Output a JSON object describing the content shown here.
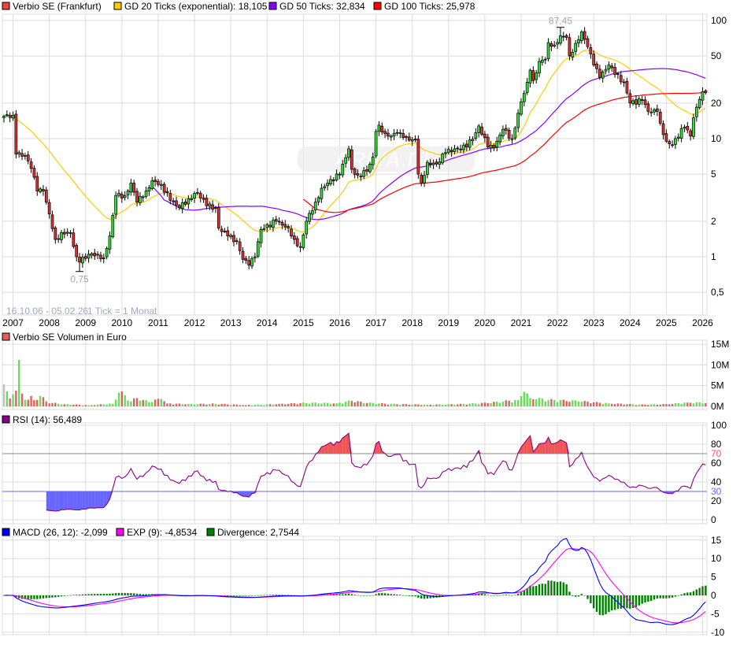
{
  "legend_main": [
    {
      "label": "Verbio SE (Frankfurt)",
      "color": "#ee4444"
    },
    {
      "label": "GD 20 Ticks (exponential): 18,105",
      "color": "#ffcc00"
    },
    {
      "label": "GD 50 Ticks: 32,834",
      "color": "#8800ff"
    },
    {
      "label": "GD 100 Ticks: 25,978",
      "color": "#ff0000"
    }
  ],
  "range_text": "16.10.06 - 05.02.26",
  "tick_text": "1 Tick = 1 Monat",
  "watermark": "ARIVA.DE",
  "chart_data": {
    "type": "candlestick",
    "title": "Verbio SE (Frankfurt)",
    "start_month": "2006-10",
    "interval": "1 month",
    "scale": "log",
    "ylim": [
      0.4,
      110
    ],
    "close_anchors": [
      [
        0,
        15.5
      ],
      [
        3,
        15.8
      ],
      [
        4,
        7.4
      ],
      [
        7,
        7.2
      ],
      [
        9,
        5.6
      ],
      [
        11,
        3.6
      ],
      [
        13,
        3.6
      ],
      [
        15,
        2.3
      ],
      [
        17,
        1.4
      ],
      [
        19,
        1.6
      ],
      [
        22,
        1.6
      ],
      [
        24,
        1.0
      ],
      [
        25,
        0.9
      ],
      [
        28,
        1.05
      ],
      [
        31,
        1.05
      ],
      [
        33,
        0.98
      ],
      [
        35,
        1.5
      ],
      [
        37,
        3.3
      ],
      [
        40,
        3.3
      ],
      [
        42,
        4.2
      ],
      [
        44,
        2.9
      ],
      [
        47,
        3.6
      ],
      [
        49,
        4.4
      ],
      [
        52,
        4.1
      ],
      [
        55,
        3.0
      ],
      [
        58,
        2.6
      ],
      [
        61,
        3.1
      ],
      [
        64,
        3.5
      ],
      [
        67,
        2.7
      ],
      [
        70,
        2.6
      ],
      [
        71,
        1.75
      ],
      [
        74,
        1.5
      ],
      [
        77,
        1.35
      ],
      [
        79,
        0.95
      ],
      [
        81,
        0.85
      ],
      [
        83,
        1.0
      ],
      [
        85,
        1.7
      ],
      [
        90,
        2.0
      ],
      [
        94,
        1.75
      ],
      [
        96,
        1.4
      ],
      [
        98,
        1.2
      ],
      [
        100,
        2.0
      ],
      [
        103,
        2.9
      ],
      [
        105,
        3.8
      ],
      [
        107,
        4.2
      ],
      [
        111,
        5.0
      ],
      [
        113,
        6.9
      ],
      [
        114,
        8.2
      ],
      [
        115,
        5.5
      ],
      [
        117,
        4.9
      ],
      [
        120,
        5.3
      ],
      [
        122,
        7.0
      ],
      [
        123,
        11.5
      ],
      [
        124,
        13.0
      ],
      [
        126,
        11.0
      ],
      [
        128,
        10.5
      ],
      [
        130,
        11.2
      ],
      [
        132,
        10.2
      ],
      [
        134,
        9.7
      ],
      [
        136,
        9.8
      ],
      [
        137,
        5.0
      ],
      [
        138,
        4.2
      ],
      [
        140,
        6.3
      ],
      [
        143,
        6.1
      ],
      [
        146,
        7.6
      ],
      [
        150,
        8.3
      ],
      [
        153,
        8.5
      ],
      [
        156,
        11.2
      ],
      [
        157,
        12.8
      ],
      [
        160,
        8.5
      ],
      [
        162,
        8.3
      ],
      [
        165,
        12.0
      ],
      [
        168,
        10.0
      ],
      [
        171,
        20.5
      ],
      [
        173,
        30
      ],
      [
        174,
        38
      ],
      [
        175,
        31
      ],
      [
        177,
        45
      ],
      [
        179,
        47
      ],
      [
        180,
        65
      ],
      [
        182,
        62
      ],
      [
        184,
        74
      ],
      [
        186,
        72
      ],
      [
        187,
        50
      ],
      [
        189,
        64
      ],
      [
        191,
        80
      ],
      [
        193,
        60
      ],
      [
        195,
        42
      ],
      [
        197,
        33
      ],
      [
        200,
        42
      ],
      [
        202,
        35
      ],
      [
        205,
        30
      ],
      [
        207,
        20
      ],
      [
        211,
        21
      ],
      [
        213,
        17
      ],
      [
        216,
        17
      ],
      [
        217,
        13.5
      ],
      [
        219,
        9.5
      ],
      [
        221,
        8.8
      ],
      [
        222,
        10
      ],
      [
        225,
        12.5
      ],
      [
        227,
        10.5
      ],
      [
        228,
        15
      ],
      [
        230,
        21.5
      ],
      [
        231,
        25
      ],
      [
        232,
        24.5
      ]
    ],
    "high": {
      "month": 184,
      "value": 87.45,
      "label": "87,45"
    },
    "low": {
      "month": 25,
      "value": 0.75,
      "label": "0,75"
    },
    "x_ticks": [
      "2007",
      "2008",
      "2009",
      "2010",
      "2011",
      "2012",
      "2013",
      "2014",
      "2015",
      "2016",
      "2017",
      "2018",
      "2019",
      "2020",
      "2021",
      "2022",
      "2023",
      "2024",
      "2025",
      "2026"
    ],
    "y_ticks": [
      {
        "v": 100,
        "label": "100"
      },
      {
        "v": 50,
        "label": "50"
      },
      {
        "v": 20,
        "label": "20"
      },
      {
        "v": 10,
        "label": "10"
      },
      {
        "v": 5,
        "label": "5"
      },
      {
        "v": 2,
        "label": "2"
      },
      {
        "v": 1,
        "label": "1"
      },
      {
        "v": 0.5,
        "label": "0,5"
      }
    ],
    "moving_averages": [
      {
        "name": "GD 20 (exponential)",
        "period": 20,
        "kind": "ema",
        "color": "#ffcc00"
      },
      {
        "name": "GD 50",
        "period": 50,
        "kind": "sma",
        "color": "#8800ff"
      },
      {
        "name": "GD 100",
        "period": 100,
        "kind": "sma",
        "color": "#ff0000"
      }
    ],
    "volume": {
      "title": "Verbio SE Volumen in Euro",
      "unit": "M EUR",
      "ylim": [
        0,
        15
      ],
      "ticks": [
        {
          "v": 15,
          "label": "15M"
        },
        {
          "v": 10,
          "label": "10M"
        },
        {
          "v": 5,
          "label": "5M"
        },
        {
          "v": 0,
          "label": "0M"
        }
      ],
      "anchors": [
        [
          0,
          5.3
        ],
        [
          1,
          3.6
        ],
        [
          2,
          1.9
        ],
        [
          3,
          2.9
        ],
        [
          4,
          3.8
        ],
        [
          5,
          11.2
        ],
        [
          6,
          3.1
        ],
        [
          7,
          1.6
        ],
        [
          8,
          1.6
        ],
        [
          9,
          2.5
        ],
        [
          10,
          1.5
        ],
        [
          12,
          2.5
        ],
        [
          14,
          1.2
        ],
        [
          16,
          0.8
        ],
        [
          20,
          0.5
        ],
        [
          28,
          0.3
        ],
        [
          36,
          0.6
        ],
        [
          38,
          3.3
        ],
        [
          39,
          3.6
        ],
        [
          40,
          2.7
        ],
        [
          42,
          1.2
        ],
        [
          44,
          2.0
        ],
        [
          46,
          1.5
        ],
        [
          48,
          1.0
        ],
        [
          52,
          1.8
        ],
        [
          54,
          0.7
        ],
        [
          60,
          0.5
        ],
        [
          70,
          0.6
        ],
        [
          80,
          0.3
        ],
        [
          90,
          0.5
        ],
        [
          100,
          0.8
        ],
        [
          110,
          0.7
        ],
        [
          115,
          1.3
        ],
        [
          120,
          0.8
        ],
        [
          130,
          0.5
        ],
        [
          140,
          0.4
        ],
        [
          150,
          0.5
        ],
        [
          160,
          0.8
        ],
        [
          170,
          1.5
        ],
        [
          172,
          3.5
        ],
        [
          174,
          2.0
        ],
        [
          180,
          1.5
        ],
        [
          190,
          1.2
        ],
        [
          200,
          0.7
        ],
        [
          210,
          0.4
        ],
        [
          220,
          0.5
        ],
        [
          226,
          0.9
        ],
        [
          232,
          0.8
        ]
      ]
    },
    "rsi": {
      "title": "RSI (14): 56,489",
      "period": 14,
      "color": "#880088",
      "ylim": [
        0,
        100
      ],
      "ticks": [
        {
          "v": 100,
          "label": "100"
        },
        {
          "v": 80,
          "label": "80"
        },
        {
          "v": 60,
          "label": "60"
        },
        {
          "v": 40,
          "label": "40"
        },
        {
          "v": 20,
          "label": "20"
        },
        {
          "v": 0,
          "label": "0"
        }
      ],
      "upper": {
        "v": 70,
        "label": "70",
        "color": "#ff5555"
      },
      "lower": {
        "v": 30,
        "label": "30",
        "color": "#6666ff"
      }
    },
    "macd": {
      "legend": [
        {
          "label": "MACD (26, 12): -2,099",
          "color": "#0000ff"
        },
        {
          "label": "EXP (9): -4,8534",
          "color": "#ff00ff"
        },
        {
          "label": "Divergence: 2,7544",
          "color": "#008000"
        }
      ],
      "ylim": [
        -10,
        15
      ],
      "ticks": [
        {
          "v": 15,
          "label": "15"
        },
        {
          "v": 10,
          "label": "10"
        },
        {
          "v": 5,
          "label": "5"
        },
        {
          "v": 0,
          "label": "0"
        },
        {
          "v": -5,
          "label": "-5"
        },
        {
          "v": -10,
          "label": "-10"
        }
      ]
    }
  }
}
